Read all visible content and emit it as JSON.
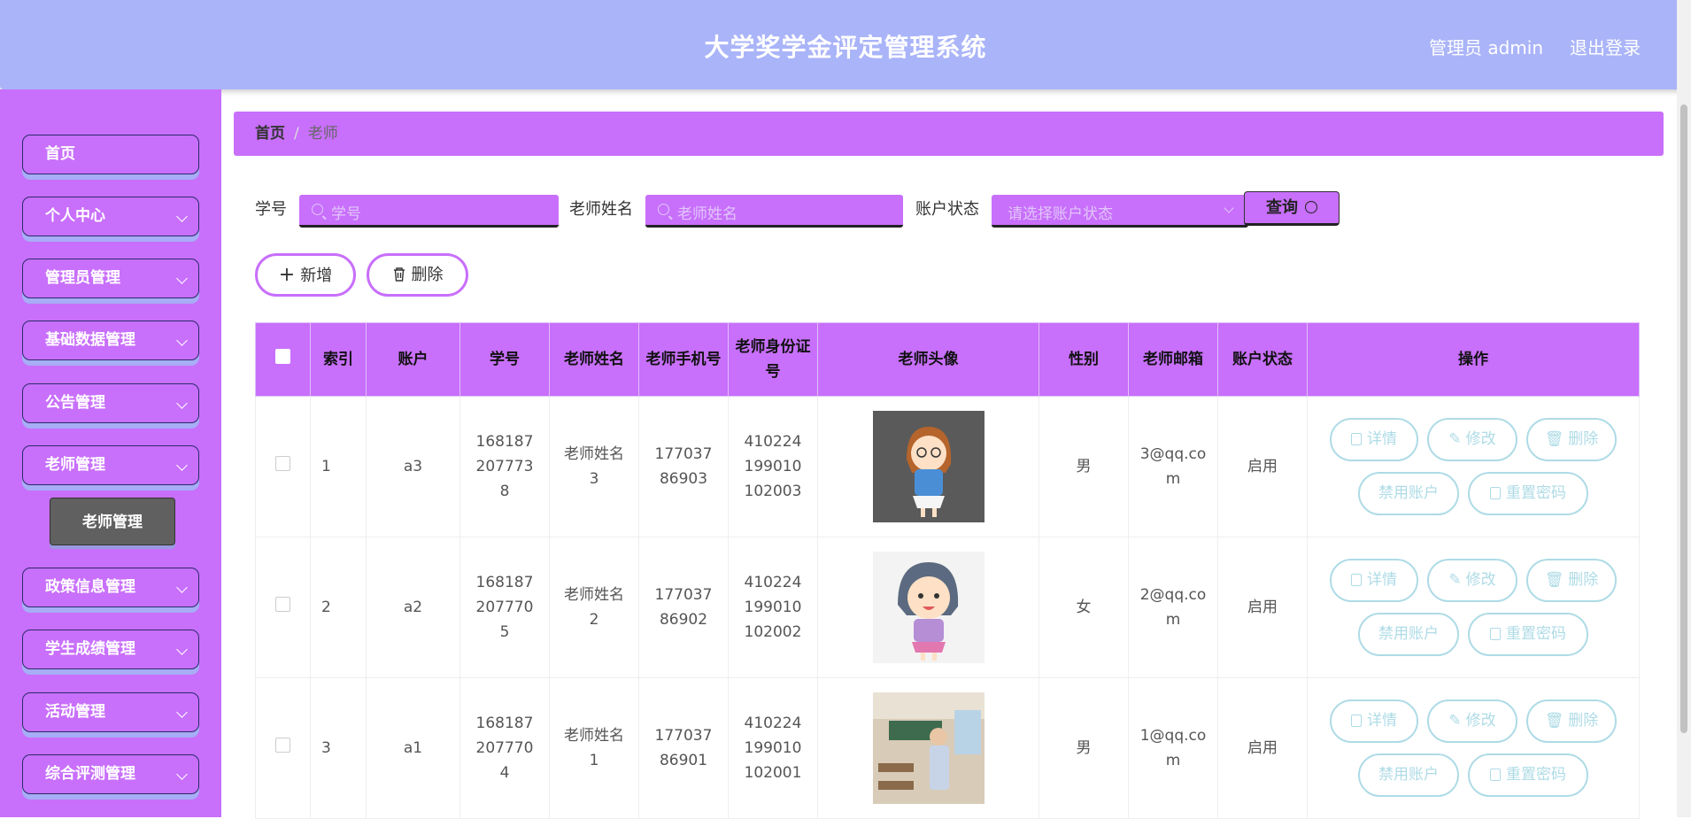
{
  "header": {
    "title": "大学奖学金评定管理系统",
    "user": "管理员 admin",
    "logout": "退出登录"
  },
  "sidebar": {
    "items": [
      {
        "label": "首页",
        "chevron": false
      },
      {
        "label": "个人中心",
        "chevron": true
      },
      {
        "label": "管理员管理",
        "chevron": true
      },
      {
        "label": "基础数据管理",
        "chevron": true
      },
      {
        "label": "公告管理",
        "chevron": true
      },
      {
        "label": "老师管理",
        "chevron": true
      },
      {
        "label": "政策信息管理",
        "chevron": true
      },
      {
        "label": "学生成绩管理",
        "chevron": true
      },
      {
        "label": "活动管理",
        "chevron": true
      },
      {
        "label": "综合评测管理",
        "chevron": true
      }
    ],
    "submenu": {
      "label": "老师管理"
    }
  },
  "breadcrumb": {
    "home": "首页",
    "separator": "/",
    "current": "老师"
  },
  "filters": {
    "student_no_label": "学号",
    "student_no_placeholder": "学号",
    "teacher_name_label": "老师姓名",
    "teacher_name_placeholder": "老师姓名",
    "status_label": "账户状态",
    "status_placeholder": "请选择账户状态",
    "query_label": "查询"
  },
  "toolbar": {
    "add_label": "新增",
    "delete_label": "删除"
  },
  "table": {
    "columns": [
      "",
      "索引",
      "账户",
      "学号",
      "老师姓名",
      "老师手机号",
      "老师身份证号",
      "老师头像",
      "性别",
      "老师邮箱",
      "账户状态",
      "操作"
    ],
    "rows": [
      {
        "index": "1",
        "account": "a3",
        "student_no": "1681872077738",
        "name": "老师姓名3",
        "phone": "17703786903",
        "id_card": "410224199010102003",
        "gender": "男",
        "email": "3@qq.com",
        "status": "启用"
      },
      {
        "index": "2",
        "account": "a2",
        "student_no": "1681872077705",
        "name": "老师姓名2",
        "phone": "17703786902",
        "id_card": "410224199010102002",
        "gender": "女",
        "email": "2@qq.com",
        "status": "启用"
      },
      {
        "index": "3",
        "account": "a1",
        "student_no": "1681872077704",
        "name": "老师姓名1",
        "phone": "17703786901",
        "id_card": "410224199010102001",
        "gender": "男",
        "email": "1@qq.com",
        "status": "启用"
      }
    ],
    "actions": {
      "detail": "详情",
      "edit": "修改",
      "delete": "删除",
      "disable": "禁用账户",
      "reset": "重置密码"
    }
  },
  "colors": {
    "header": "#aab4f8",
    "sidebar": "#c86ffb",
    "accent": "#c86ffb",
    "action": "#aedbe6"
  }
}
